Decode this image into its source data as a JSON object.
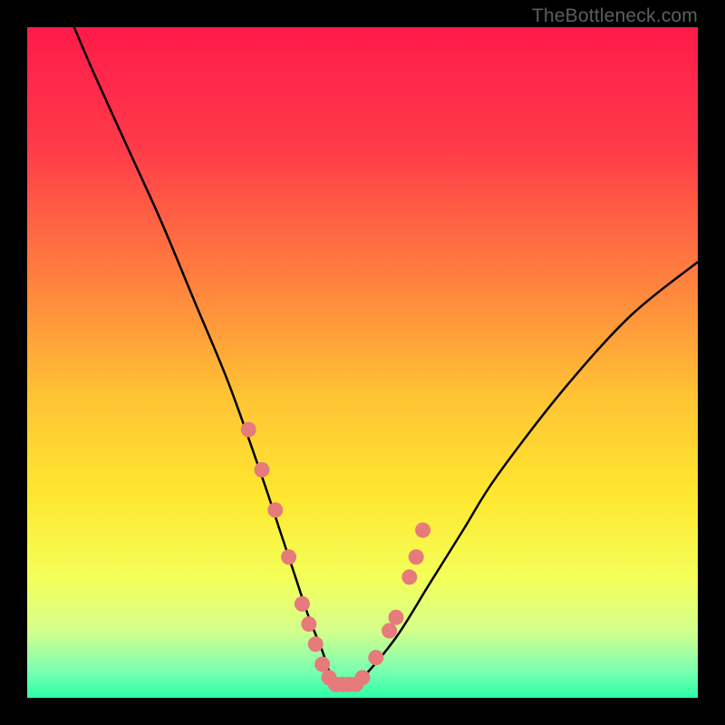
{
  "watermark": "TheBottleneck.com",
  "chart_data": {
    "type": "line",
    "title": "",
    "xlabel": "",
    "ylabel": "",
    "xlim": [
      0,
      100
    ],
    "ylim": [
      0,
      100
    ],
    "grid": false,
    "legend": false,
    "series": [
      {
        "name": "bottleneck-curve",
        "type": "line",
        "color": "#000000",
        "x": [
          7,
          10,
          15,
          20,
          25,
          30,
          35,
          38,
          40,
          42,
          44,
          45,
          46,
          48,
          50,
          55,
          60,
          65,
          70,
          80,
          90,
          100
        ],
        "y": [
          100,
          93,
          82,
          71,
          59,
          47,
          33,
          24,
          18,
          12,
          7,
          4,
          2,
          2,
          3,
          9,
          17,
          25,
          33,
          46,
          57,
          65
        ]
      },
      {
        "name": "sample-points",
        "type": "scatter",
        "color": "#e77a7a",
        "x": [
          33,
          35,
          37,
          39,
          41,
          42,
          43,
          44,
          45,
          46,
          47,
          48,
          49,
          50,
          52,
          54,
          55,
          57,
          58,
          59
        ],
        "y": [
          40,
          34,
          28,
          21,
          14,
          11,
          8,
          5,
          3,
          2,
          2,
          2,
          2,
          3,
          6,
          10,
          12,
          18,
          21,
          25
        ]
      }
    ],
    "background_gradient": {
      "stops": [
        {
          "pos": 0.0,
          "color": "#ff1a4a"
        },
        {
          "pos": 0.18,
          "color": "#ff3b49"
        },
        {
          "pos": 0.38,
          "color": "#ff823e"
        },
        {
          "pos": 0.55,
          "color": "#ffc334"
        },
        {
          "pos": 0.7,
          "color": "#ffe82f"
        },
        {
          "pos": 0.82,
          "color": "#f4ff58"
        },
        {
          "pos": 0.9,
          "color": "#d4ff8c"
        },
        {
          "pos": 0.96,
          "color": "#7affb0"
        },
        {
          "pos": 1.0,
          "color": "#2cffa8"
        }
      ]
    }
  }
}
